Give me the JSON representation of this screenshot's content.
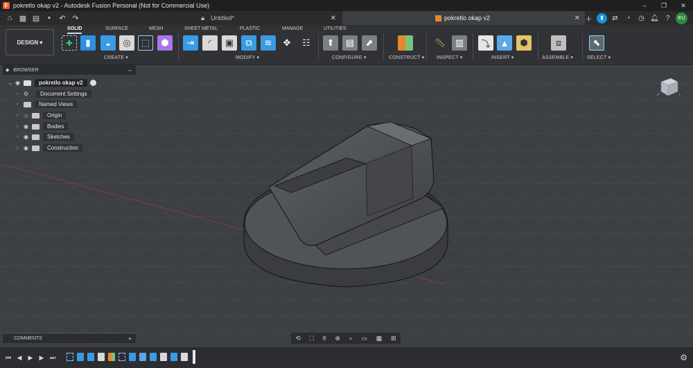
{
  "window": {
    "title": "pokretlo okap v2 - Autodesk Fusion Personal (Not for Commercial Use)",
    "logo_letter": "F",
    "controls": [
      "–",
      "❐",
      "✕"
    ]
  },
  "tabs": [
    {
      "label": "Untitled*",
      "icon": "lock-icon",
      "active": false
    },
    {
      "label": "pokretlo okap v2",
      "icon": "cube-icon",
      "active": true
    }
  ],
  "user": {
    "initials": "EU"
  },
  "workspace": {
    "label": "DESIGN ▾"
  },
  "ribbon_tabs": [
    "SOLID",
    "SURFACE",
    "MESH",
    "SHEET METAL",
    "PLASTIC",
    "MANAGE",
    "UTILITIES"
  ],
  "active_ribbon_tab": "SOLID",
  "groups": {
    "create": "CREATE ▾",
    "modify": "MODIFY ▾",
    "configure": "CONFIGURE ▾",
    "construct": "CONSTRUCT ▾",
    "inspect": "INSPECT ▾",
    "insert": "INSERT ▾",
    "assemble": "ASSEMBLE ▾",
    "select": "SELECT ▾"
  },
  "browser": {
    "title": "BROWSER",
    "root": "pokretlo okap v2",
    "items": [
      {
        "label": "Document Settings",
        "icon": "gear-icon",
        "visible_toggle": false
      },
      {
        "label": "Named Views",
        "icon": "folder-icon",
        "visible_toggle": false
      },
      {
        "label": "Origin",
        "icon": "folder-icon",
        "visible_toggle": true,
        "hidden": true
      },
      {
        "label": "Bodies",
        "icon": "folder-icon",
        "visible_toggle": true
      },
      {
        "label": "Sketches",
        "icon": "folder-icon",
        "visible_toggle": true
      },
      {
        "label": "Construction",
        "icon": "folder-icon",
        "visible_toggle": true
      }
    ]
  },
  "comments": {
    "label": "COMMENTS"
  },
  "colors": {
    "accent": "#1a8fe0",
    "viewport_bg": "#3c3f44",
    "model": "#4a4c50",
    "orange": "#e8862b"
  }
}
